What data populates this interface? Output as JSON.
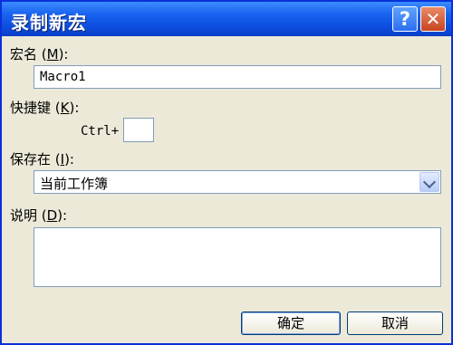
{
  "window": {
    "title": "录制新宏"
  },
  "titlebar": {
    "help_glyph": "?",
    "close_glyph": "✕"
  },
  "macro_name": {
    "label_prefix": "宏名 (",
    "mnemonic": "M",
    "label_suffix": "):",
    "value": "Macro1"
  },
  "shortcut": {
    "label_prefix": "快捷键 (",
    "mnemonic": "K",
    "label_suffix": "):",
    "ctrl_label": "Ctrl+",
    "value": ""
  },
  "store_in": {
    "label_prefix": "保存在 (",
    "mnemonic": "I",
    "label_suffix": "):",
    "selected": "当前工作簿"
  },
  "description": {
    "label_prefix": "说明 (",
    "mnemonic": "D",
    "label_suffix": "):",
    "value": ""
  },
  "buttons": {
    "ok": "确定",
    "cancel": "取消"
  }
}
